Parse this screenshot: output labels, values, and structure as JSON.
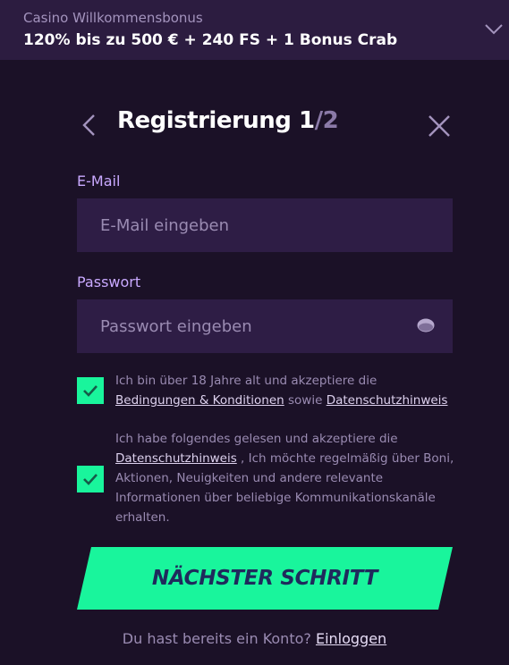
{
  "promo": {
    "label": "Casino Willkommensbonus",
    "value": "120% bis zu 500 € + 240 FS + 1 Bonus Crab"
  },
  "header": {
    "title": "Registrierung",
    "step_current": "1",
    "step_separator": "/",
    "step_total": "2"
  },
  "email": {
    "label": "E-Mail",
    "placeholder": "E-Mail eingeben",
    "value": ""
  },
  "password": {
    "label": "Passwort",
    "placeholder": "Passwort eingeben",
    "value": ""
  },
  "consent_age": {
    "checked": true,
    "text_1": "Ich bin über 18 Jahre alt und akzeptiere die",
    "link_terms": "Bedingungen & Konditionen",
    "text_2": " sowie ",
    "link_privacy": "Datenschutzhinweis"
  },
  "consent_marketing": {
    "checked": true,
    "text_1": "Ich habe folgendes gelesen und akzeptiere die",
    "link_privacy": "Datenschutzhinweis",
    "text_2": " , Ich möchte regelmäßig über Boni, Aktionen, Neuigkeiten und andere relevante Informationen über beliebige Kommunikationskanäle erhalten."
  },
  "next_button": {
    "label": "NÄCHSTER SCHRITT"
  },
  "login": {
    "prompt": "Du hast bereits ein Konto?",
    "link": "Einloggen"
  },
  "colors": {
    "background": "#1b1127",
    "promo_bar": "#2c1c40",
    "input_bg": "#2e1d45",
    "accent_green": "#19f59c",
    "label_purple": "#c9a9ff",
    "button_text": "#1f2a5c"
  },
  "icons": {
    "promo_toggle": "chevron-down-icon",
    "back": "chevron-left-icon",
    "close": "close-icon",
    "password_toggle": "eye-icon",
    "checkbox_mark": "check-icon"
  }
}
